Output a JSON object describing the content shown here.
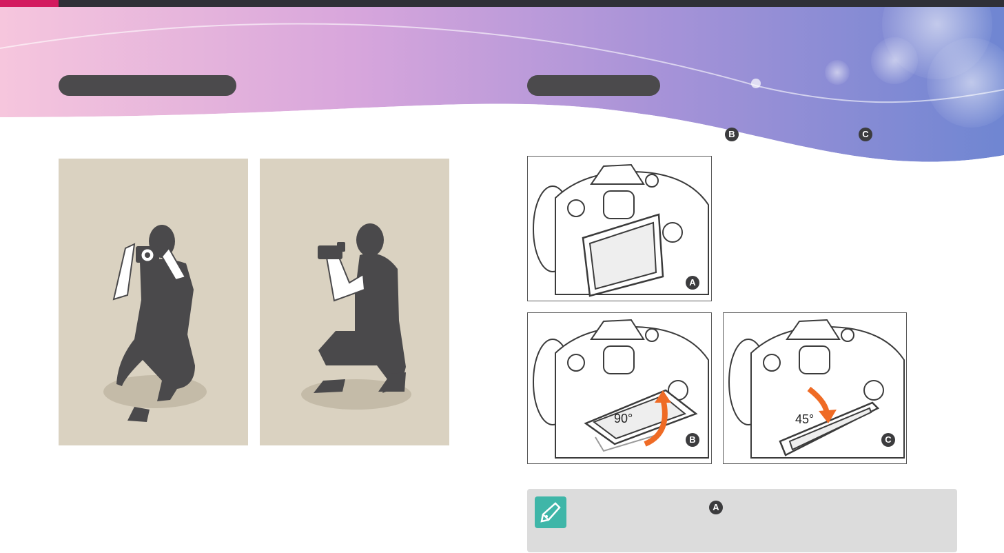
{
  "page": {
    "left_title": "",
    "right_title": "",
    "left_body": "",
    "right_body": "",
    "note_text": ""
  },
  "labels": {
    "angle_90": "90°",
    "angle_45": "45°",
    "badge_a": "A",
    "badge_b": "B",
    "badge_c": "C"
  },
  "colors": {
    "top_bar": "#2f3037",
    "accent": "#d31a5f",
    "pill": "#4b4a4c",
    "photo_bg": "#dad2c1",
    "figure": "#4a494b",
    "arrow": "#ef6b25",
    "note_bg": "#dcdcdc",
    "note_icon": "#3fb6a8"
  },
  "icons": {
    "note": "pen-nib-icon"
  }
}
